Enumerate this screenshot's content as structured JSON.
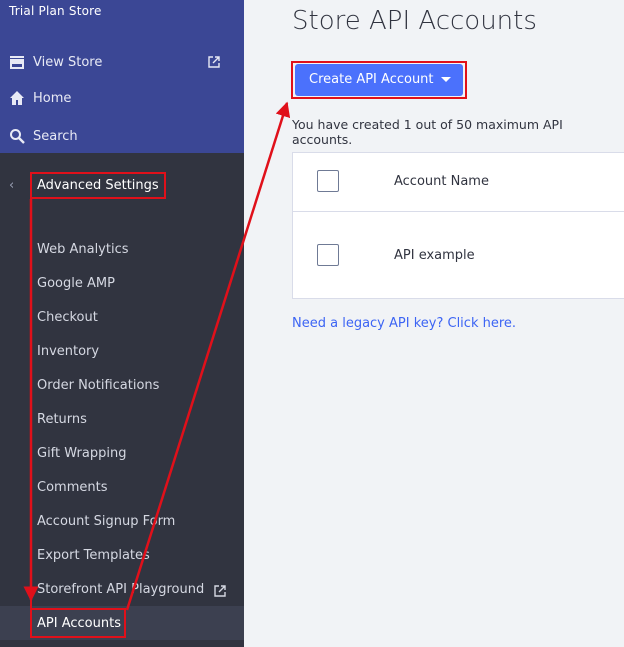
{
  "sidebar": {
    "store_name": "Trial Plan Store",
    "top_nav": [
      {
        "label": "View Store",
        "icon": "store-icon"
      },
      {
        "label": "Home",
        "icon": "home-icon"
      },
      {
        "label": "Search",
        "icon": "search-icon"
      }
    ],
    "section_title": "Advanced Settings",
    "items": [
      {
        "label": "Web Analytics"
      },
      {
        "label": "Google AMP"
      },
      {
        "label": "Checkout"
      },
      {
        "label": "Inventory"
      },
      {
        "label": "Order Notifications"
      },
      {
        "label": "Returns"
      },
      {
        "label": "Gift Wrapping"
      },
      {
        "label": "Comments"
      },
      {
        "label": "Account Signup Form"
      },
      {
        "label": "Export Templates"
      },
      {
        "label": "Storefront API Playground"
      },
      {
        "label": "API Accounts",
        "active": true
      }
    ]
  },
  "main": {
    "title": "Store API Accounts",
    "create_button": "Create API Account",
    "info_text": "You have created 1 out of 50 maximum API accounts.",
    "table": {
      "columns": [
        "Account Name"
      ],
      "rows": [
        [
          "API example"
        ]
      ]
    },
    "legacy_link": "Need a legacy API key? Click here."
  },
  "colors": {
    "sidebar_top": "#3b4795",
    "sidebar_bottom": "#313440",
    "button": "#4b71fc",
    "annotation": "#e0101a",
    "link": "#3c64f4"
  }
}
